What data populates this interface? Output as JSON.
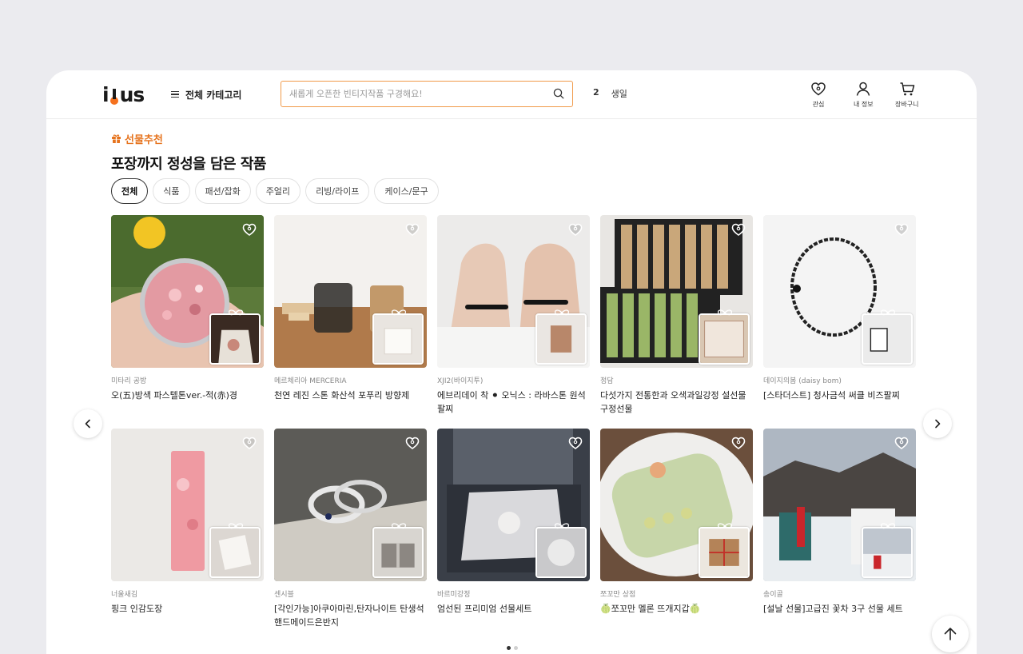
{
  "header": {
    "logo_text": "idus",
    "category_label": "전체 카테고리",
    "search_placeholder": "새롭게 오픈한 빈티지작품 구경해요!",
    "rank_number": "2",
    "rank_keyword": "생일",
    "nav": [
      {
        "label": "관심",
        "icon": "heart-icon"
      },
      {
        "label": "내 정보",
        "icon": "person-icon"
      },
      {
        "label": "장바구니",
        "icon": "cart-icon"
      }
    ]
  },
  "section": {
    "eyebrow": "선물추천",
    "title": "포장까지 정성을 담은 작품"
  },
  "chips": [
    "전체",
    "식품",
    "패션/잡화",
    "주얼리",
    "리빙/라이프",
    "케이스/문구"
  ],
  "active_chip": "전체",
  "products": [
    {
      "seller": "미타리 공방",
      "name": "오(五)방색 파스텔톤ver.-적(赤)경"
    },
    {
      "seller": "메르체리아 MERCERIA",
      "name": "천연 레진 스톤 화산석 포푸리 방향제"
    },
    {
      "seller": "XJI2(바이지투)",
      "name": "에브리데이 착 ⚫ 오닉스 : 라바스톤 원석 팔찌"
    },
    {
      "seller": "정담",
      "name": "다섯가지 전통한과 오색과일강정 설선물 구정선물"
    },
    {
      "seller": "데이지의봄 (daisy bom)",
      "name": "[스타더스트] 청사금석 써클 비즈팔찌"
    },
    {
      "seller": "너울새김",
      "name": "핑크 인감도장"
    },
    {
      "seller": "센시블",
      "name": "[각인가능]아쿠아마린,탄자나이트 탄생석 핸드메이드은반지"
    },
    {
      "seller": "바르미강정",
      "name": "엄선된 프리미엄 선물세트"
    },
    {
      "seller": "쪼꼬만 상점",
      "name": "🍈쪼꼬만 멜론 뜨개지갑🍈"
    },
    {
      "seller": "송이골",
      "name": "[설날 선물]고급진 꽃차 3구 선물 세트"
    }
  ],
  "carousel": {
    "pages": 2,
    "current": 1
  },
  "colors": {
    "accent": "#f5711e",
    "eyebrow": "#e6741f",
    "search_border": "#f19a4a"
  }
}
